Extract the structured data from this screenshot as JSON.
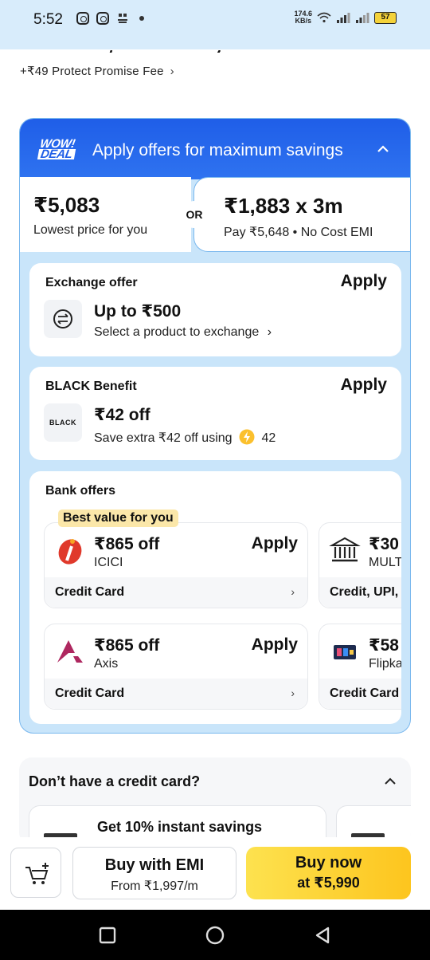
{
  "status_bar": {
    "time": "5:52",
    "speed_value": "174.6",
    "speed_unit": "KB/s",
    "battery": "57"
  },
  "fee": {
    "text": "+₹49 Protect Promise Fee",
    "chevron": "›"
  },
  "offers": {
    "badge_top": "WOW!",
    "badge_bottom": "DEAL",
    "header": "Apply offers for maximum savings",
    "price_left": {
      "amount": "₹5,083",
      "label": "Lowest price for you"
    },
    "or": "OR",
    "price_right": {
      "amount": "₹1,883 x 3m",
      "label": "Pay ₹5,648 • No Cost EMI"
    },
    "exchange": {
      "title": "Exchange offer",
      "apply": "Apply",
      "headline": "Up to ₹500",
      "sub": "Select a product to exchange",
      "chevron": "›"
    },
    "black": {
      "title": "BLACK Benefit",
      "apply": "Apply",
      "logo_text": "BLACK",
      "headline": "₹42 off",
      "sub": "Save extra ₹42 off using",
      "coins": "42"
    },
    "bank": {
      "title": "Bank offers",
      "best_tag": "Best value for you",
      "tiles": [
        {
          "amount": "₹865 off",
          "bank": "ICICI",
          "apply": "Apply",
          "footer": "Credit Card",
          "chevron": "›"
        },
        {
          "amount": "₹30",
          "bank": "MULT",
          "footer": "Credit, UPI,"
        },
        {
          "amount": "₹865 off",
          "bank": "Axis",
          "apply": "Apply",
          "footer": "Credit Card",
          "chevron": "›"
        },
        {
          "amount": "₹58",
          "bank": "Flipka",
          "footer": "Credit Card"
        }
      ]
    }
  },
  "credit_section": {
    "title": "Don’t have a credit card?",
    "tile_text": "Get 10% instant savings"
  },
  "actions": {
    "emi_label": "Buy with EMI",
    "emi_sub": "From ₹1,997/m",
    "buy_label": "Buy now",
    "buy_sub": "at ₹5,990"
  },
  "colors": {
    "status_bg": "#d8ecfb",
    "offer_header": "#2264ea",
    "offer_bg": "#c9e5fa",
    "buy_yellow": "#fdd42f"
  }
}
